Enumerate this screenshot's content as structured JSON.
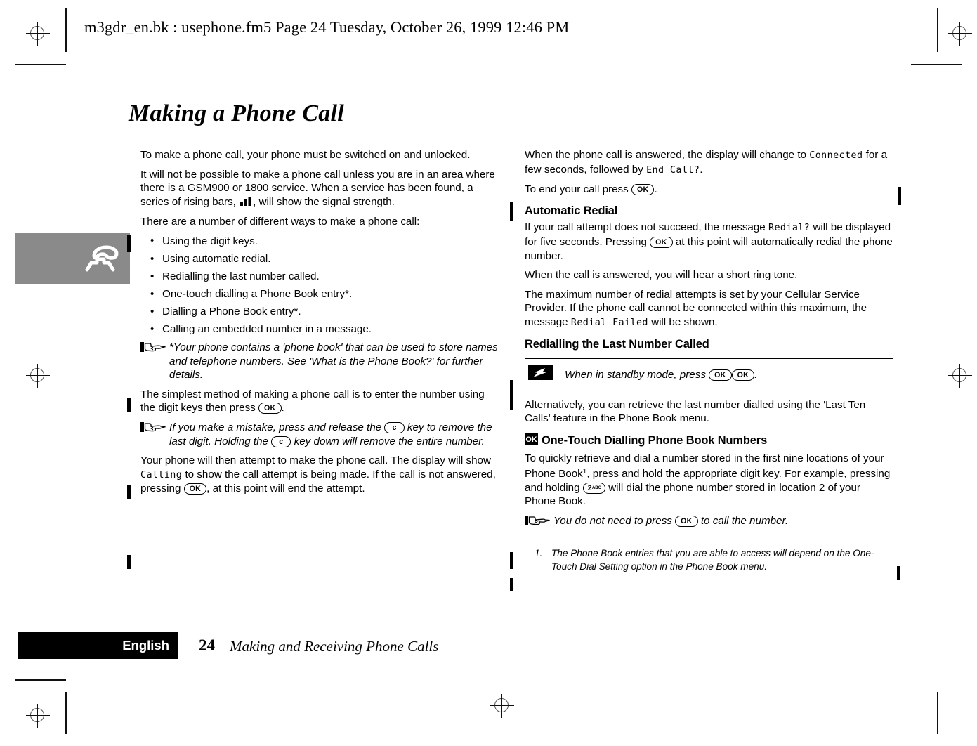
{
  "document_header": "m3gdr_en.bk : usephone.fm5  Page 24  Tuesday, October 26, 1999  12:46 PM",
  "page_title": "Making a Phone Call",
  "left_column": {
    "para_1": "To make a phone call, your phone must be switched on and unlocked.",
    "para_2_before_icon": "It will not be possible to make a phone call unless you are in an area where there is a GSM900 or 1800 service. When a service has been found, a series of rising bars, ",
    "para_2_after_icon": ", will show the signal strength.",
    "para_3": "There are a number of different ways to make a phone call:",
    "bullets": [
      "Using the digit keys.",
      "Using automatic redial.",
      "Redialling the last number called.",
      "One-touch dialling a Phone Book entry*.",
      "Dialling a Phone Book entry*.",
      "Calling an embedded number in a message."
    ],
    "note_1": "*Your phone contains a 'phone book' that can be used to store names and telephone numbers. See 'What is the Phone Book?' for further details.",
    "para_4_a": "The simplest method of making a phone call is to enter the number using the digit keys then press ",
    "para_4_b": ".",
    "note_2_a": "If you make a mistake, press and release the ",
    "note_2_b": " key to remove the last digit. Holding the ",
    "note_2_c": " key down will remove the entire number.",
    "para_5_a": "Your phone will then attempt to make the phone call. The display will show ",
    "para_5_lcd": "Calling",
    "para_5_b": " to show the call attempt is being made. If the call is not answered, pressing ",
    "para_5_c": ", at this point will end the attempt."
  },
  "right_column": {
    "para_1_a": "When the phone call is answered, the display will change to ",
    "para_1_lcd_1": "Connected",
    "para_1_b": " for a few seconds, followed by ",
    "para_1_lcd_2": "End Call?",
    "para_1_c": ".",
    "para_2_a": "To end your call press ",
    "para_2_b": ".",
    "heading_automatic_redial": "Automatic Redial",
    "para_3_a": "If your call attempt does not succeed, the message ",
    "para_3_lcd": "Redial?",
    "para_3_b": " will be displayed for five seconds. Pressing ",
    "para_3_c": " at this point will automatically redial the phone number.",
    "para_4": "When the call is answered, you will hear a short ring tone.",
    "para_5_a": "The maximum number of redial attempts is set by your Cellular Service Provider. If the phone call cannot be connected within this maximum, the message ",
    "para_5_lcd": "Redial Failed",
    "para_5_b": " will be shown.",
    "heading_redialling": "Redialling the Last Number Called",
    "tip_a": "When in standby mode, press ",
    "tip_b": ".",
    "para_6": "Alternatively, you can retrieve the last number dialled using the 'Last Ten Calls' feature in the Phone Book menu.",
    "heading_one_touch": "One-Touch Dialling Phone Book Numbers",
    "para_7_a": "To quickly retrieve and dial a number stored in the first nine locations of your Phone Book",
    "para_7_sup": "1",
    "para_7_b": ", press and hold the appropriate digit key. For example, pressing and holding ",
    "para_7_c": " will dial the phone number stored in location 2 of your Phone Book.",
    "note_3_a": "You do not need to press ",
    "note_3_b": " to call the number.",
    "footnote_number": "1.",
    "footnote_text": "The Phone Book entries that you are able to access will depend on the One-Touch Dial Setting option in the Phone Book menu."
  },
  "keys": {
    "ok": "OK",
    "clear": "c",
    "two_digit": "2",
    "two_letters": "ABC"
  },
  "footer": {
    "language": "English",
    "page_number": "24",
    "chapter": "Making and Receiving Phone Calls"
  },
  "colors": {
    "ink": "#000000",
    "paper": "#ffffff",
    "tab_grey": "#8a8a8a",
    "regmark_grey": "#555555"
  }
}
